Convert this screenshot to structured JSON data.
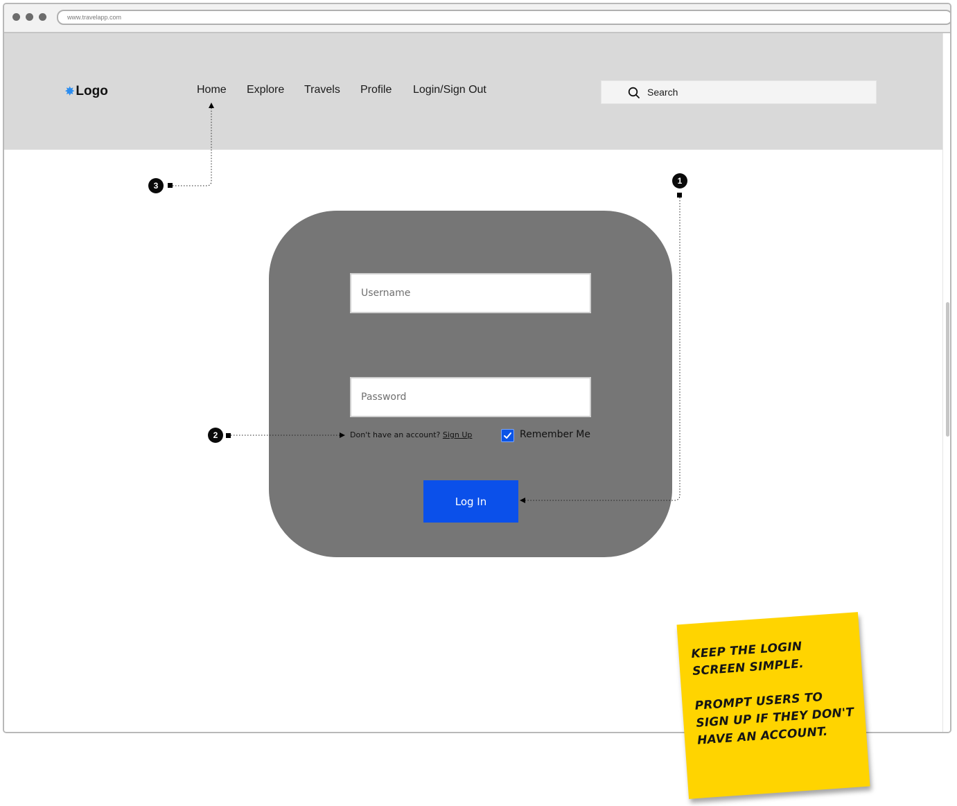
{
  "browser": {
    "url": "www.travelapp.com"
  },
  "header": {
    "logo_text": "Logo",
    "nav": [
      {
        "label": "Home"
      },
      {
        "label": "Explore"
      },
      {
        "label": "Travels"
      },
      {
        "label": "Profile"
      },
      {
        "label": "Login/Sign Out"
      }
    ],
    "search_placeholder": "Search"
  },
  "login": {
    "username_placeholder": "Username",
    "password_placeholder": "Password",
    "signup_prompt": "Don't have an account?",
    "signup_link": "Sign Up",
    "remember_label": "Remember Me",
    "remember_checked": true,
    "login_button": "Log In"
  },
  "annotations": [
    {
      "number": "1"
    },
    {
      "number": "2"
    },
    {
      "number": "3"
    }
  ],
  "sticky_note": {
    "line1": "Keep the login screen simple.",
    "line2": "Prompt users to sign up if they don't have an account."
  },
  "colors": {
    "accent_blue": "#0b50ea",
    "navbar_gray": "#d9d9d9",
    "card_gray": "#767676",
    "sticky_yellow": "#ffd400"
  }
}
